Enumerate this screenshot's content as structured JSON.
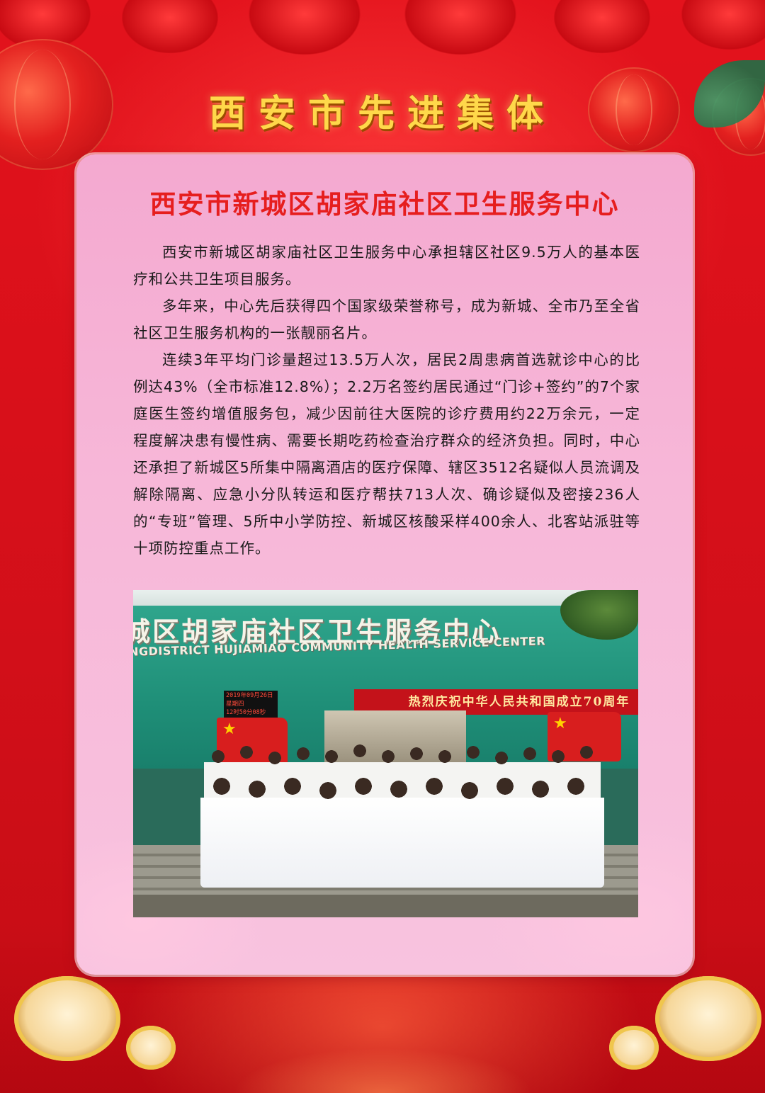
{
  "poster": {
    "heading": "西安市先进集体",
    "org_name": "西安市新城区胡家庙社区卫生服务中心",
    "paragraphs": [
      "西安市新城区胡家庙社区卫生服务中心承担辖区社区9.5万人的基本医疗和公共卫生项目服务。",
      "多年来，中心先后获得四个国家级荣誉称号，成为新城、全市乃至全省社区卫生服务机构的一张靓丽名片。",
      "连续3年平均门诊量超过13.5万人次，居民2周患病首选就诊中心的比例达43%（全市标准12.8%）；2.2万名签约居民通过“门诊+签约”的7个家庭医生签约增值服务包，减少因前往大医院的诊疗费用约22万余元，一定程度解决患有慢性病、需要长期吃药检查治疗群众的经济负担。同时，中心还承担了新城区5所集中隔离酒店的医疗保障、辖区3512名疑似人员流调及解除隔离、应急小分队转运和医疗帮扶713人次、确诊疑似及密接236人的“专班”管理、5所中小学防控、新城区核酸采样400余人、北客站派驻等十项防控重点工作。"
    ]
  },
  "photo": {
    "sign_cn": "城区胡家庙社区卫生服务中心",
    "sign_en": "NGDISTRICT HUJIAMIAO COMMUNITY HEALTH SERVICE CENTER",
    "banner": "热烈庆祝中华人民共和国成立70周年",
    "clock_lines": [
      "2019年09月26日",
      "星期四",
      "12时50分08秒"
    ]
  },
  "colors": {
    "background_red": "#d8101a",
    "heading_gold": "#ffd84a",
    "panel_pink": "#f7b7d8",
    "title_red": "#e61e1e"
  },
  "icons": [
    "curtain",
    "lantern",
    "drum",
    "national-flag-icon"
  ]
}
